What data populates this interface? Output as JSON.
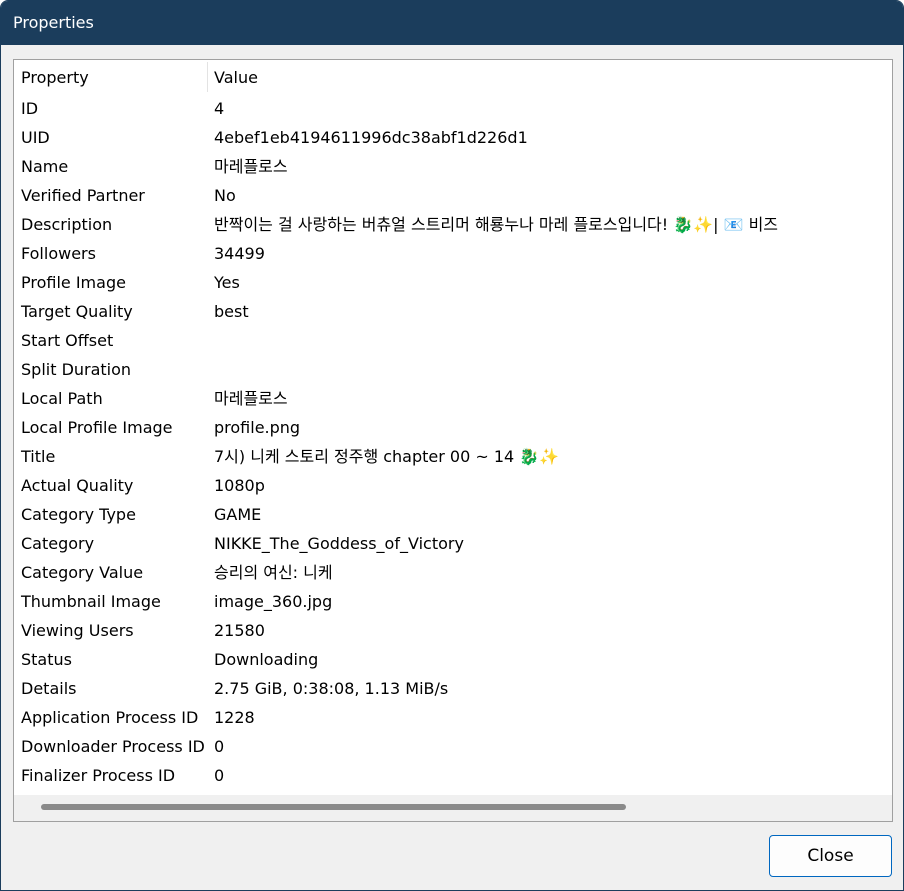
{
  "window": {
    "title": "Properties"
  },
  "columns": {
    "property": "Property",
    "value": "Value"
  },
  "rows": [
    {
      "property": "ID",
      "value": "4"
    },
    {
      "property": "UID",
      "value": "4ebef1eb4194611996dc38abf1d226d1"
    },
    {
      "property": "Name",
      "value": "마레플로스"
    },
    {
      "property": "Verified Partner",
      "value": "No"
    },
    {
      "property": "Description",
      "value": "반짝이는 걸 사랑하는 버츄얼 스트리머 해룡누나 마레 플로스입니다! 🐉✨| 📧 비즈"
    },
    {
      "property": "Followers",
      "value": "34499"
    },
    {
      "property": "Profile Image",
      "value": "Yes"
    },
    {
      "property": "Target Quality",
      "value": "best"
    },
    {
      "property": "Start Offset",
      "value": ""
    },
    {
      "property": "Split Duration",
      "value": ""
    },
    {
      "property": "Local Path",
      "value": "마레플로스"
    },
    {
      "property": "Local Profile Image",
      "value": "profile.png"
    },
    {
      "property": "Title",
      "value": "7시) 니케 스토리 정주행 chapter 00 ~ 14 🐉✨"
    },
    {
      "property": "Actual Quality",
      "value": "1080p"
    },
    {
      "property": "Category Type",
      "value": "GAME"
    },
    {
      "property": "Category",
      "value": "NIKKE_The_Goddess_of_Victory"
    },
    {
      "property": "Category Value",
      "value": "승리의 여신: 니케"
    },
    {
      "property": "Thumbnail Image",
      "value": "image_360.jpg"
    },
    {
      "property": "Viewing Users",
      "value": "21580"
    },
    {
      "property": "Status",
      "value": "Downloading"
    },
    {
      "property": "Details",
      "value": "2.75 GiB, 0:38:08, 1.13 MiB/s"
    },
    {
      "property": "Application Process ID",
      "value": "1228"
    },
    {
      "property": "Downloader Process ID",
      "value": "0"
    },
    {
      "property": "Finalizer Process ID",
      "value": "0"
    }
  ],
  "footer": {
    "close_label": "Close"
  }
}
